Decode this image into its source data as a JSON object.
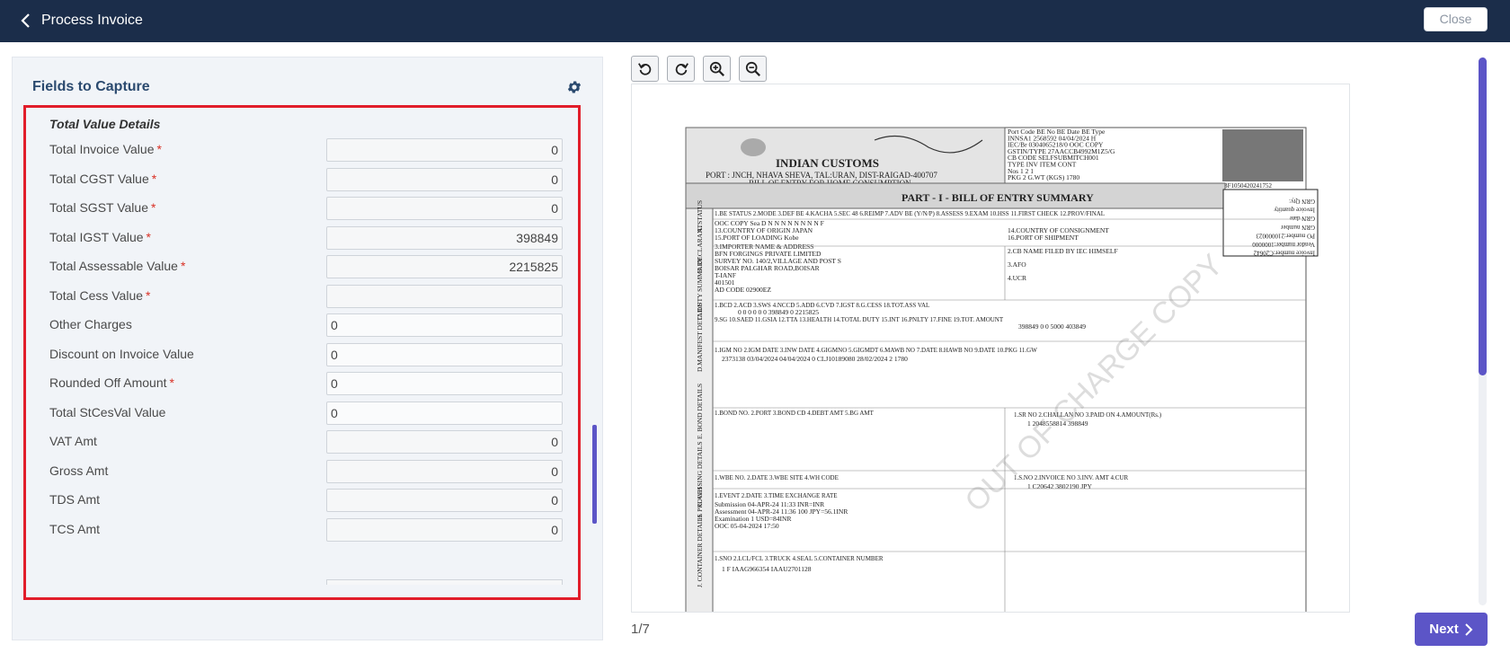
{
  "header": {
    "back_label": "Process Invoice",
    "close_label": "Close"
  },
  "panel": {
    "title": "Fields to Capture",
    "section_title": "Total Value Details"
  },
  "fields": [
    {
      "label": "Total Invoice Value",
      "required": "*",
      "value": "0",
      "align": "num"
    },
    {
      "label": "Total CGST Value",
      "required": "*",
      "value": "0",
      "align": "num"
    },
    {
      "label": "Total SGST Value",
      "required": "*",
      "value": "0",
      "align": "num"
    },
    {
      "label": "Total IGST Value",
      "required": "*",
      "value": "398849",
      "align": "num"
    },
    {
      "label": "Total Assessable Value",
      "required": "*",
      "value": "2215825",
      "align": "num"
    },
    {
      "label": "Total Cess Value",
      "required": "*",
      "value": "",
      "align": "num"
    },
    {
      "label": "Other Charges",
      "required": "",
      "value": "0",
      "align": "txt"
    },
    {
      "label": "Discount on Invoice Value",
      "required": "",
      "value": "0",
      "align": "txt"
    },
    {
      "label": "Rounded Off Amount",
      "required": "*",
      "value": "0",
      "align": "txt"
    },
    {
      "label": "Total StCesVal Value",
      "required": "",
      "value": "0",
      "align": "txt"
    },
    {
      "label": "VAT Amt",
      "required": "",
      "value": "0",
      "align": "num"
    },
    {
      "label": "Gross Amt",
      "required": "",
      "value": "0",
      "align": "num"
    },
    {
      "label": "TDS Amt",
      "required": "",
      "value": "0",
      "align": "num"
    },
    {
      "label": "TCS Amt",
      "required": "",
      "value": "0",
      "align": "num"
    }
  ],
  "viewer": {
    "page_indicator": "1/7",
    "next_label": "Next",
    "tools": [
      "rotate-left-icon",
      "rotate-right-icon",
      "zoom-in-icon",
      "zoom-out-icon"
    ]
  },
  "document": {
    "authority": "INDIAN    CUSTOMS",
    "port": "PORT : JNCH, NHAVA SHEVA, TAL:URAN, DIST-RAIGAD-400707",
    "bill_title": "BILL OF ENTRY FOR HOME CONSUMPTION",
    "part_title": "PART - I  -  BILL OF ENTRY SUMMARY",
    "header_rows": [
      "Port Code    BE No     BE Date    BE Type",
      "INNSA1      2568592   04/04/2024     H",
      "IEC/Br        0304065218/0          OOC COPY",
      "GSTIN/TYPE     27AACCB4992M1Z5/G",
      "CB CODE        SELFSUBMITCH001",
      "TYPE           INV       ITEM      CONT",
      "Nos             1          2          1",
      "PKG             2      G.WT (KGS)  1780"
    ],
    "status_row": "1.BE STATUS  2.MODE  3.DEF BE  4.KACHA  5.SEC 48  6.REIMP  7.ADV BE (Y/N/P)  8.ASSESS  9.EXAM  10.HSS  11.FIRST CHECK  12.PROV/FINAL",
    "status_vals": "OOC COPY    Sea     D     N     N     N     N     N     N     N     N     F",
    "origin": "13.COUNTRY OF ORIGIN                    JAPAN",
    "consignment": "14.COUNTRY OF CONSIGNMENT",
    "loading": "15.PORT OF LOADING                       Kobe",
    "shipment": "16.PORT OF SHIPMENT",
    "importer_lines": [
      "3.IMPORTER  NAME & ADDRESS",
      "BFN FORGINGS PRIVATE LIMITED",
      "SURVEY NO. 140/2,VILLAGE AND POST S",
      "BOISAR PALGHAR ROAD,BOISAR",
      "T-IANF",
      "401501",
      "AD CODE       02900EZ"
    ],
    "cb_name": "2.CB NAME   FILED BY IEC HIMSELF",
    "afo": "3.AFO",
    "ucr": "4.UCR",
    "duty_head": "1.BCD    2.ACD    3.SWS    4.NCCD   5.ADD    6.CVD    7.IGST    8.G.CESS   18.TOT.ASS VAL",
    "duty_vals": "0          0          0          0          0          0       398849       0          2215825",
    "duty_head2": "9.SG    10.SAED    11.GSIA    12.TTA    13.HEALTH    14.TOTAL DUTY    15.INT    16.PNLTY    17.FINE    19.TOT. AMOUNT",
    "duty_vals2": "398849      0       0      5000      403849",
    "manifest_head": "1.IGM NO    2.IGM DATE    3.INW DATE    4.GIGMNO    5.GIGMDT    6.MAWB NO    7.DATE    8.HAWB NO    9.DATE    10.PKG    11.GW",
    "manifest_vals": "2373138      03/04/2024     04/04/2024      0             CLJ10189080    28/02/2024                        2      1780",
    "bond_head": "1.BOND NO.   2.PORT   3.BOND CD   4.DEBT AMT   5.BG AMT",
    "payment_head": "1.SR NO   2.CHALLAN NO   3.PAID ON   4.AMOUNT(Rs.)",
    "payment_vals": "1      2048558814                          398849",
    "wbe_head": "1.WBE NO.   2.DATE   3.WBE SITE   4.WH CODE",
    "invoice_head": "1.S.NO   2.INVOICE NO   3.INV. AMT   4.CUR",
    "invoice_vals": "1        C20642        3802190      JPY",
    "process_head": "1.EVENT    2.DATE    3.TIME    EXCHANGE RATE",
    "process_rows": [
      "Submission   04-APR-24   11:33   INR=INR",
      "Assessment   04-APR-24   11:36   100 JPY=56.1INR",
      "Examination                      1 USD=84INR",
      "OOC          05-04-2024  17:50"
    ],
    "container_head": "1.SNO  2.LCL/FCL  3.TRUCK   4.SEAL   5.CONTAINER NUMBER",
    "container_vals": "1      F                  IAAG966354   IAAU2701128",
    "stamp_lines": [
      "GRN Qty:",
      "Invoice quantity",
      "GRN date",
      "GRN number",
      "PO number:210000023",
      "Vendor number:1000000",
      "Invoice number:C20642"
    ],
    "watermark": "OUT OF CHARGE COPY",
    "qr_code_ref": "BF1050420241752",
    "side_labels": [
      "A. STATUS",
      "B. DECLARANT",
      "C. DUTY SUMMARY",
      "D.MANIFEST DETAILS",
      "E. BOND DETAILS",
      "F. PAYMENT DETAILS",
      "G. WH",
      "H. PROCESSING DETAILS",
      "I. INVOICE DETAILS - SUMMARY",
      "J. CONTAINER DETAILS"
    ]
  }
}
